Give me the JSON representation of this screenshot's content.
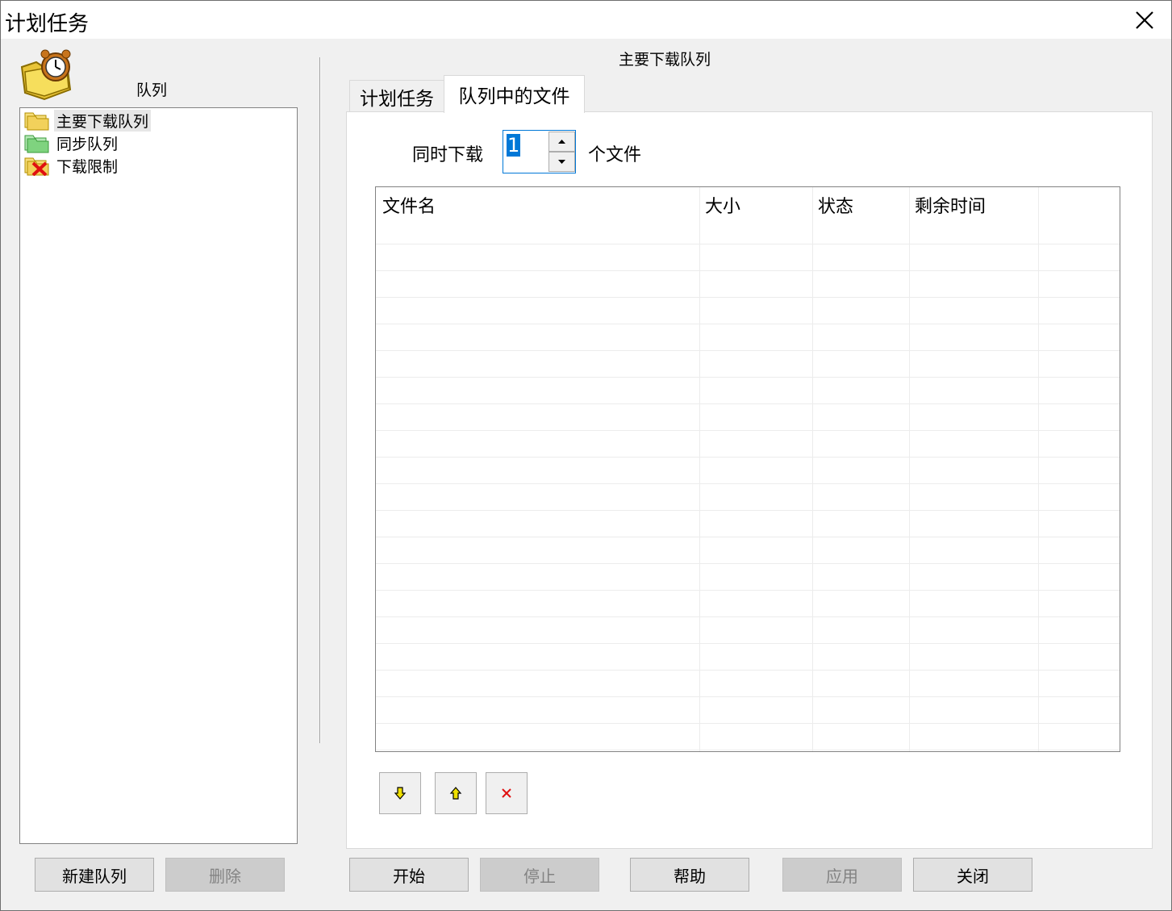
{
  "window": {
    "title": "计划任务"
  },
  "left_panel": {
    "label": "队列",
    "tree": [
      {
        "label": "主要下载队列",
        "icon": "yellow-folder-icon",
        "selected": true
      },
      {
        "label": "同步队列",
        "icon": "green-folder-icon",
        "selected": false
      },
      {
        "label": "下载限制",
        "icon": "red-x-folder-icon",
        "selected": false
      }
    ],
    "buttons": {
      "new_queue": "新建队列",
      "delete": "删除"
    }
  },
  "right_panel": {
    "heading": "主要下载队列",
    "tabs": [
      {
        "label": "计划任务",
        "active": false
      },
      {
        "label": "队列中的文件",
        "active": true
      }
    ],
    "concurrent": {
      "label": "同时下载",
      "value": "1",
      "unit": "个文件"
    },
    "file_list": {
      "columns": [
        "文件名",
        "大小",
        "状态",
        "剩余时间"
      ],
      "rows": []
    },
    "row_buttons": [
      "move-down-icon",
      "move-up-icon",
      "delete-icon"
    ]
  },
  "footer": {
    "start": "开始",
    "stop": "停止",
    "help": "帮助",
    "apply": "应用",
    "close": "关闭"
  },
  "colors": {
    "selection": "#0078d7",
    "folder_yellow": "#f2d15b",
    "folder_green": "#7fd37f",
    "delete_red": "#e01010"
  }
}
